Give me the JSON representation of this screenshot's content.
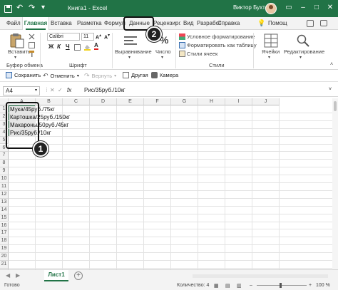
{
  "app": {
    "title": "Книга1  -  Excel",
    "user": "Виктор Бухтеев",
    "accent_color": "#217346"
  },
  "tabs": [
    {
      "label": "Файл"
    },
    {
      "label": "Главная"
    },
    {
      "label": "Вставка"
    },
    {
      "label": "Разметка ст"
    },
    {
      "label": "Формулы"
    },
    {
      "label": "Данные"
    },
    {
      "label": "Рецензиров"
    },
    {
      "label": "Вид"
    },
    {
      "label": "Разработч"
    },
    {
      "label": "Справка"
    },
    {
      "label": "Помощ"
    }
  ],
  "ribbon": {
    "paste": "Вставить",
    "clipboard_group": "Буфер обмена",
    "font_name": "Calibri",
    "font_size": "11",
    "font_group": "Шрифт",
    "alignment": "Выравнивание",
    "number": "Число",
    "conditional": "Условное форматирование",
    "format_table": "Форматировать как таблицу",
    "cell_styles": "Стили ячеек",
    "styles_group": "Стили",
    "cells": "Ячейки",
    "editing": "Редактирование",
    "bold": "Ж",
    "italic": "К",
    "underline": "Ч"
  },
  "quick_toolbar": {
    "save": "Сохранить",
    "undo": "Отменить",
    "redo": "Вернуть",
    "other": "Другая",
    "camera": "Камера"
  },
  "formula_bar": {
    "name_box": "A4",
    "fx": "fx",
    "formula": "Рис/35руб./10кг"
  },
  "columns": [
    "A",
    "B",
    "C",
    "D",
    "E",
    "F",
    "G",
    "H",
    "I",
    "J"
  ],
  "rows": [
    "1",
    "2",
    "3",
    "4",
    "5",
    "6",
    "7",
    "8",
    "9",
    "10",
    "11",
    "12",
    "13",
    "14",
    "15",
    "16",
    "17",
    "18",
    "19",
    "20",
    "21",
    "22"
  ],
  "cells": [
    "Мука/45руб./75кг",
    "Картошка/25руб./150кг",
    "Макароны/50руб./45кг",
    "Рис/35руб./10кг"
  ],
  "sheet_tab": "Лист1",
  "status": {
    "ready": "Готово",
    "count": "Количество: 4",
    "zoom": "100 %"
  },
  "annotations": [
    "1",
    "2"
  ]
}
